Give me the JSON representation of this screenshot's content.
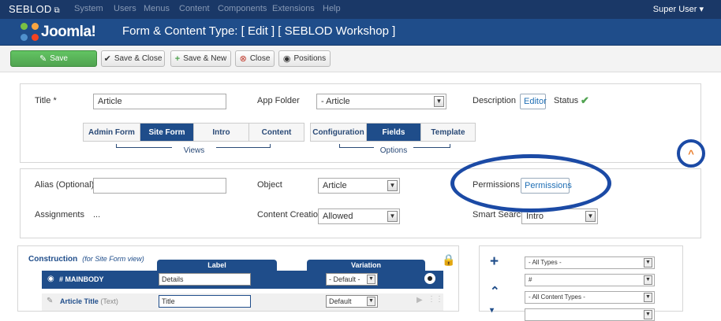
{
  "topbar": {
    "brand": "SEBLOD",
    "brand_icon": "external-link-icon",
    "menu": [
      "System",
      "Users",
      "Menus",
      "Content",
      "Components",
      "Extensions",
      "Help"
    ],
    "user": "Super User ▾"
  },
  "header": {
    "logo_text": "Joomla!",
    "title": "Form & Content Type: [ Edit ] [ SEBLOD Workshop ]"
  },
  "toolbar": {
    "save": "Save",
    "save_close": "Save & Close",
    "save_new": "Save & New",
    "close": "Close",
    "positions": "Positions"
  },
  "form": {
    "title_label": "Title",
    "title_required": "*",
    "title_value": "Article",
    "app_folder_label": "App Folder",
    "app_folder_value": "- Article",
    "description_label": "Description",
    "description_button": "Editor",
    "status_label": "Status",
    "status_icon": "check-icon"
  },
  "views_tabs": {
    "items": [
      "Admin Form",
      "Site Form",
      "Intro",
      "Content"
    ],
    "active": "Site Form",
    "caption": "Views"
  },
  "options_tabs": {
    "items": [
      "Configuration",
      "Fields",
      "Template"
    ],
    "active": "Fields",
    "caption": "Options"
  },
  "settings": {
    "alias_label": "Alias (Optional)",
    "alias_value": "",
    "object_label": "Object",
    "object_value": "Article",
    "permissions_label": "Permissions",
    "permissions_button": "Permissions",
    "assignments_label": "Assignments",
    "assignments_value": "...",
    "content_creation_label": "Content Creation",
    "content_creation_value": "Allowed",
    "smart_search_label": "Smart Search",
    "smart_search_value": "Intro"
  },
  "construction": {
    "title": "Construction",
    "subtitle": "(for Site Form view)",
    "label_header": "Label",
    "variation_header": "Variation",
    "rows": [
      {
        "name": "# MAINBODY",
        "label": "Details",
        "variation": "- Default -"
      },
      {
        "name": "Article Title",
        "type": "(Text)",
        "label": "Title",
        "variation": "Default"
      }
    ]
  },
  "filters": {
    "types": "- All Types -",
    "search": "#",
    "content_types": "- All Content Types -"
  },
  "colors": {
    "topbar": "#1a3867",
    "header": "#1f4d8a",
    "accent": "#1f4d8a",
    "save_green": "#51a351",
    "annotation_blue": "#1b4aa5",
    "collapse_orange": "#e87722"
  }
}
